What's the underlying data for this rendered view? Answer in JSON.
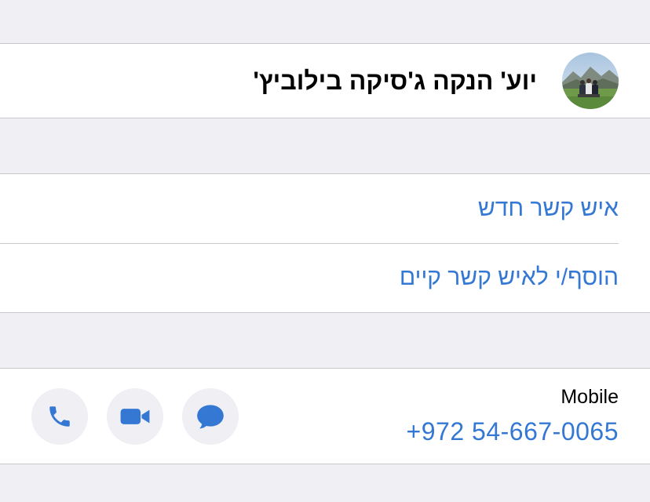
{
  "contact": {
    "name": "יוע' הנקה ג'סיקה בילוביץ'",
    "avatar_icon": "contact-photo"
  },
  "actions": {
    "new_contact_label": "איש קשר חדש",
    "add_existing_label": "הוסף/י לאיש קשר קיים"
  },
  "phone": {
    "type": "Mobile",
    "number": "+972 54-667-0065",
    "buttons": {
      "call_icon": "phone-icon",
      "video_icon": "video-camera-icon",
      "message_icon": "message-bubble-icon"
    }
  },
  "colors": {
    "accent": "#3478d4",
    "background": "#efeff4",
    "separator": "#c8c7cc"
  }
}
